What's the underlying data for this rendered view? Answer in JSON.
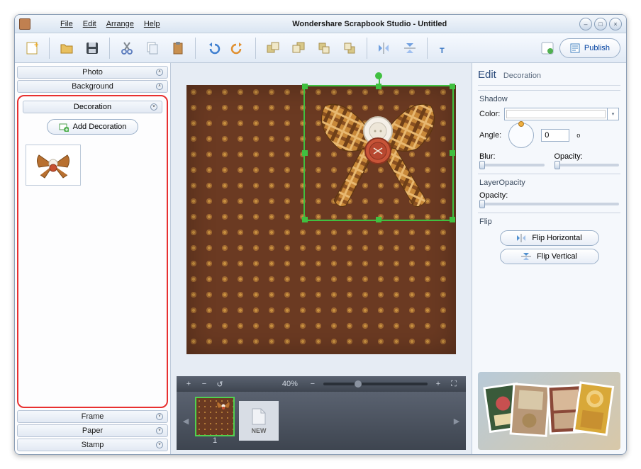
{
  "app": {
    "title": "Wondershare Scrapbook Studio - Untitled"
  },
  "menus": {
    "file": "File",
    "edit": "Edit",
    "arrange": "Arrange",
    "help": "Help"
  },
  "toolbar": {
    "publish": "Publish"
  },
  "sidebar": {
    "accordion": {
      "photo": "Photo",
      "background": "Background",
      "decoration": "Decoration",
      "frame": "Frame",
      "paper": "Paper",
      "stamp": "Stamp"
    },
    "add_decoration": "Add Decoration"
  },
  "canvas": {
    "zoom": "40%",
    "pages": {
      "p1_label": "1",
      "new_label": "NEW"
    }
  },
  "right": {
    "title": "Edit",
    "subtitle": "Decoration",
    "shadow": {
      "group": "Shadow",
      "color_label": "Color:",
      "color_value": "#ffffff",
      "angle_label": "Angle:",
      "angle_value": "0",
      "angle_unit": "o",
      "blur_label": "Blur:",
      "opacity_label": "Opacity:"
    },
    "layer_opacity": {
      "group": "LayerOpacity",
      "opacity_label": "Opacity:"
    },
    "flip": {
      "group": "Flip",
      "horizontal": "Flip Horizontal",
      "vertical": "Flip Vertical"
    }
  }
}
